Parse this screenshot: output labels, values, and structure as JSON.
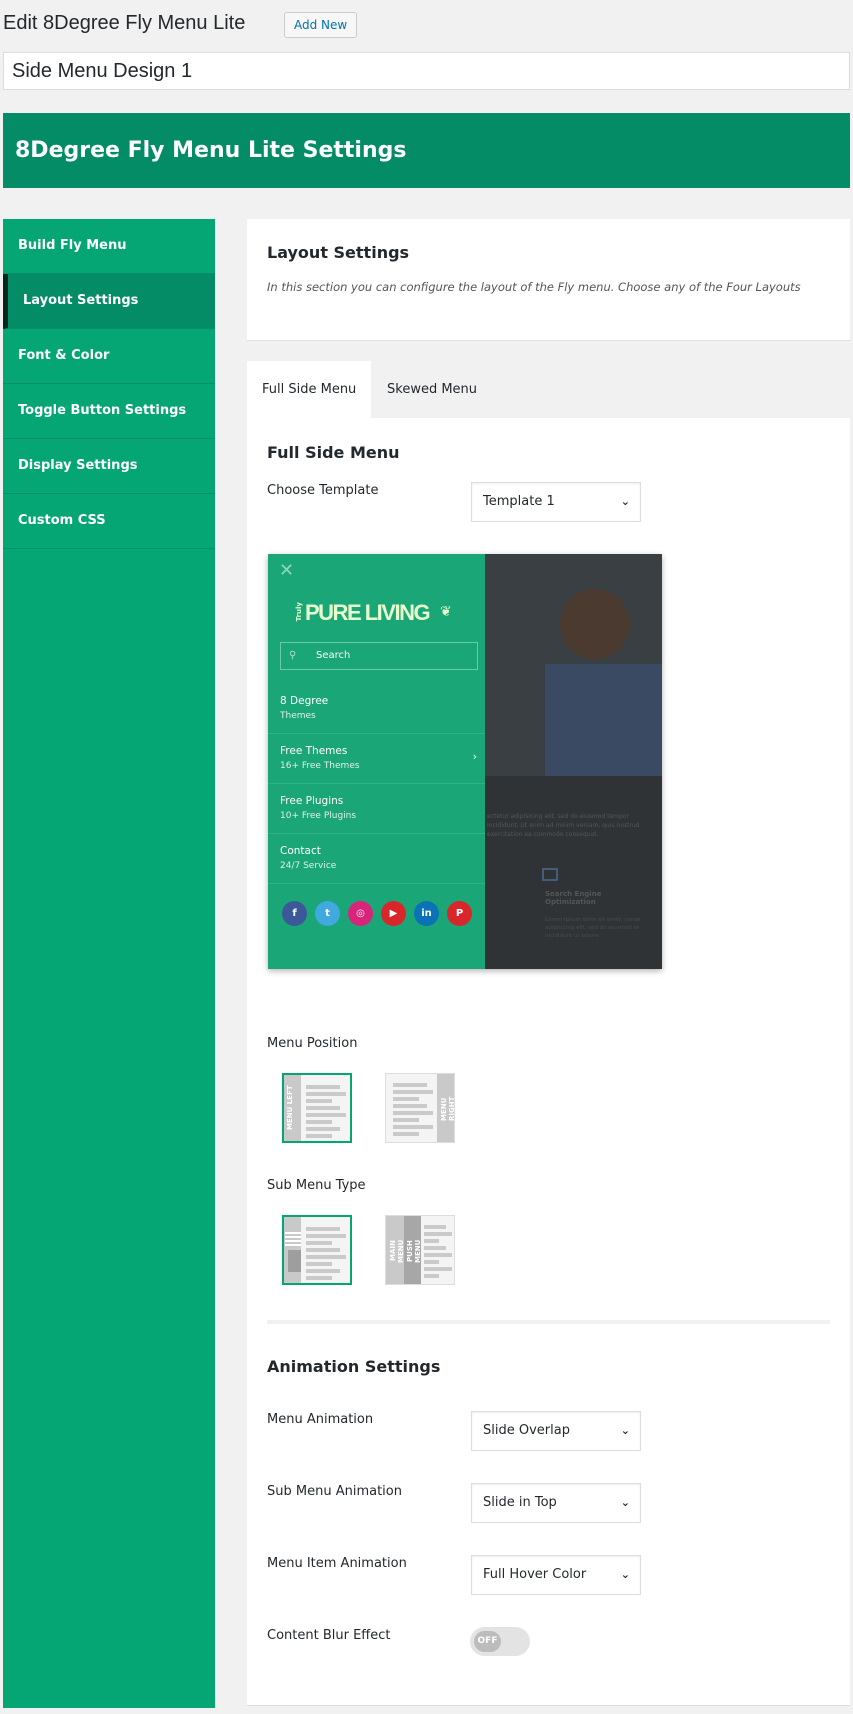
{
  "page": {
    "title": "Edit 8Degree Fly Menu Lite",
    "add_new": "Add New",
    "menu_name": "Side Menu Design 1"
  },
  "header": {
    "title": "8Degree Fly Menu Lite Settings"
  },
  "sidebar": {
    "items": [
      {
        "label": "Build Fly Menu"
      },
      {
        "label": "Layout Settings",
        "active": true
      },
      {
        "label": "Font & Color"
      },
      {
        "label": "Toggle Button Settings"
      },
      {
        "label": "Display Settings"
      },
      {
        "label": "Custom CSS"
      }
    ]
  },
  "layout": {
    "title": "Layout Settings",
    "description": "In this section you can configure the layout of the Fly menu. Choose any of the Four Layouts"
  },
  "tabs": [
    {
      "label": "Full Side Menu",
      "active": true
    },
    {
      "label": "Skewed Menu"
    }
  ],
  "full_side": {
    "title": "Full Side Menu",
    "choose_template_label": "Choose Template",
    "template_value": "Template 1",
    "preview": {
      "logo_small": "Truly",
      "logo": "PURE LIVING",
      "search": "Search",
      "items": [
        {
          "title": "8 Degree",
          "sub": "Themes"
        },
        {
          "title": "Free Themes",
          "sub": "16+ Free Themes"
        },
        {
          "title": "Free Plugins",
          "sub": "10+ Free Plugins"
        },
        {
          "title": "Contact",
          "sub": "24/7 Service"
        }
      ],
      "bg_lorem": "ectetur adipisicing elit, sed do eiusmod tempor incididunt. Ut enim ad minim veniam, quis nostrud exercitation ea commodo consequat.",
      "bg_feature": "Search Engine Optimization",
      "bg_feature_text": "Lorem ipsum dolor sit amet, conse adipisicing elit, sed do eiusmod te incididunt ut labore",
      "social": [
        "facebook",
        "twitter",
        "instagram",
        "youtube",
        "linkedin",
        "pinterest"
      ]
    },
    "menu_position_label": "Menu Position",
    "menu_left": "MENU LEFT",
    "menu_right": "MENU RIGHT",
    "menu_position_selected": "left",
    "sub_menu_type_label": "Sub Menu Type",
    "main_menu": "MAIN MENU",
    "push_menu": "PUSH MENU",
    "sub_menu_type_selected": "first"
  },
  "animation": {
    "title": "Animation Settings",
    "rows": [
      {
        "label": "Menu Animation",
        "value": "Slide Overlap"
      },
      {
        "label": "Sub Menu Animation",
        "value": "Slide in Top"
      },
      {
        "label": "Menu Item Animation",
        "value": "Full Hover Color"
      }
    ],
    "blur_label": "Content Blur Effect",
    "blur_state": "OFF"
  },
  "colors": {
    "brand": "#05a574",
    "header": "#038c65"
  }
}
